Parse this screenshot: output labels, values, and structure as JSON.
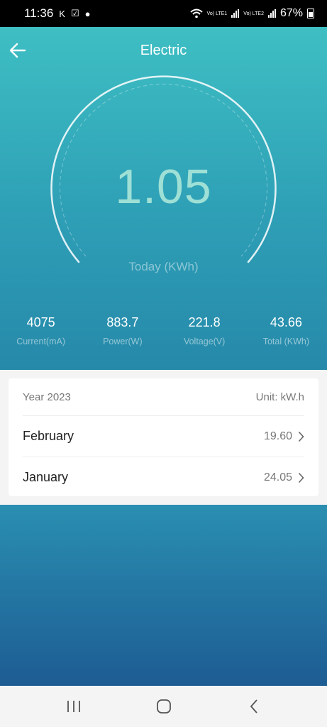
{
  "status_bar": {
    "time": "11:36",
    "battery": "67%",
    "sim1": "Vo) LTE1",
    "sim2": "Vo) LTE2"
  },
  "header": {
    "title": "Electric"
  },
  "gauge": {
    "value": "1.05",
    "label": "Today (KWh)"
  },
  "stats": [
    {
      "value": "4075",
      "label": "Current(mA)"
    },
    {
      "value": "883.7",
      "label": "Power(W)"
    },
    {
      "value": "221.8",
      "label": "Voltage(V)"
    },
    {
      "value": "43.66",
      "label": "Total (KWh)"
    }
  ],
  "history": {
    "year": "Year 2023",
    "unit": "Unit: kW.h",
    "months": [
      {
        "name": "February",
        "value": "19.60"
      },
      {
        "name": "January",
        "value": "24.05"
      }
    ]
  },
  "colors": {
    "gradient_top": "#3ebfc3",
    "gradient_bottom": "#1d5c93",
    "gauge_value": "#9fe0d6"
  }
}
